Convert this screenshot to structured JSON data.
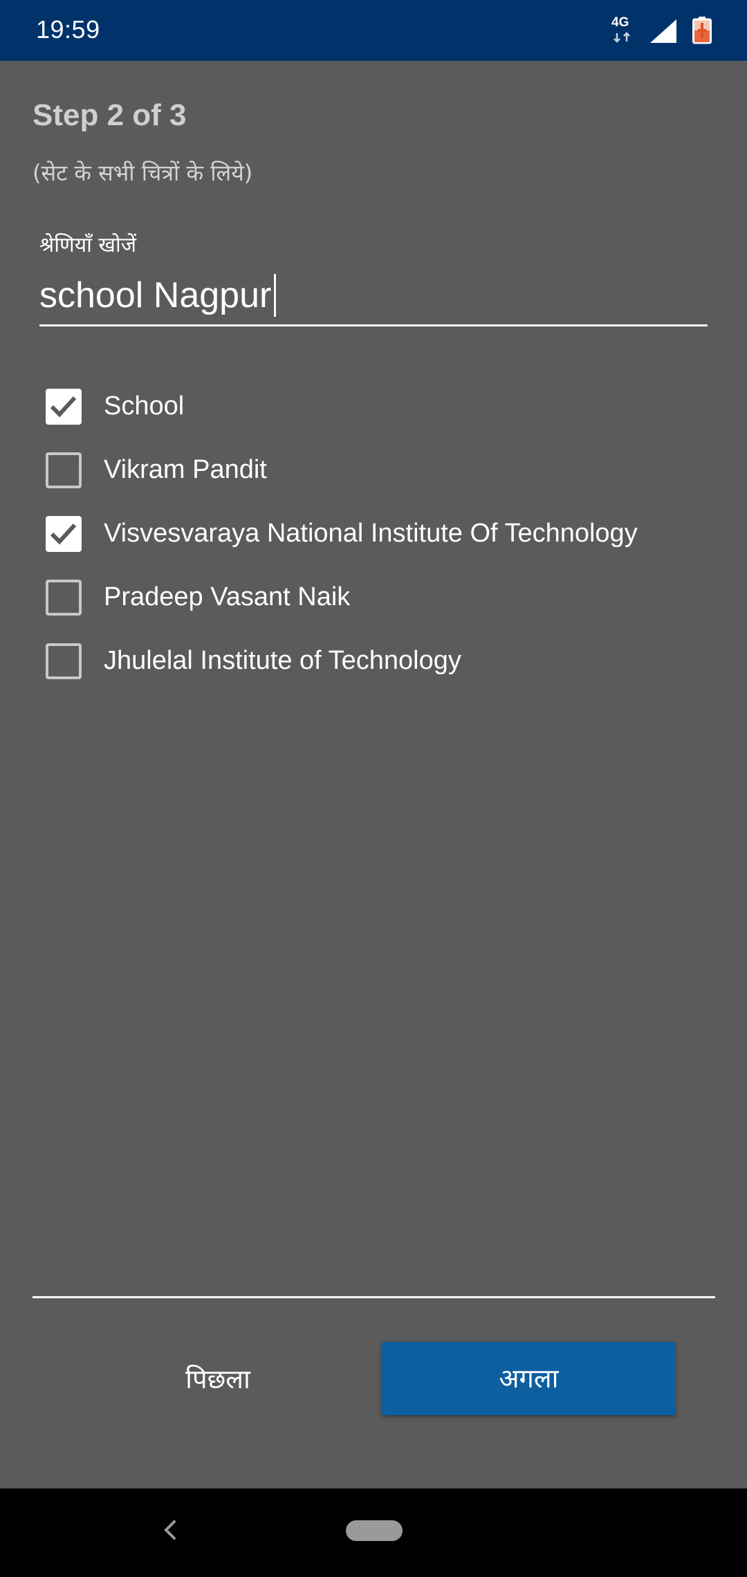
{
  "status_bar": {
    "time": "19:59",
    "network_label": "4G",
    "icons": [
      "network-4g-icon",
      "signal-icon",
      "battery-icon"
    ]
  },
  "step": {
    "title": "Step 2 of 3",
    "subtitle": "(सेट के सभी चित्रों के लिये)"
  },
  "search": {
    "label": "श्रेणियाँ खोजें",
    "value": "school Nagpur",
    "placeholder": ""
  },
  "categories": [
    {
      "label": "School",
      "checked": true
    },
    {
      "label": "Vikram Pandit",
      "checked": false
    },
    {
      "label": "Visvesvaraya National Institute Of Technology",
      "checked": true
    },
    {
      "label": "Pradeep Vasant Naik",
      "checked": false
    },
    {
      "label": "Jhulelal Institute of Technology",
      "checked": false
    }
  ],
  "buttons": {
    "previous": "पिछला",
    "next": "अगला"
  },
  "colors": {
    "status_bar": "#01336a",
    "background": "#5b5b5b",
    "primary_button": "#0e5fa0",
    "nav_bar": "#000000"
  }
}
